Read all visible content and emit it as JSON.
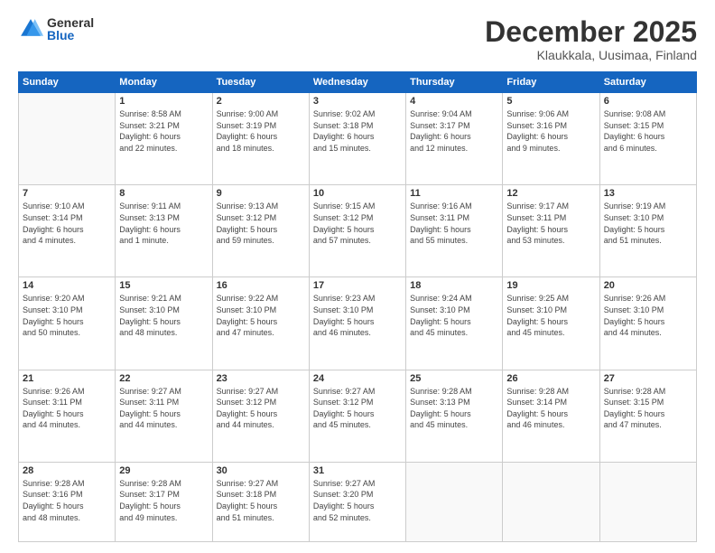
{
  "logo": {
    "general": "General",
    "blue": "Blue"
  },
  "title": "December 2025",
  "subtitle": "Klaukkala, Uusimaa, Finland",
  "days": [
    "Sunday",
    "Monday",
    "Tuesday",
    "Wednesday",
    "Thursday",
    "Friday",
    "Saturday"
  ],
  "weeks": [
    [
      {
        "num": "",
        "text": ""
      },
      {
        "num": "1",
        "text": "Sunrise: 8:58 AM\nSunset: 3:21 PM\nDaylight: 6 hours\nand 22 minutes."
      },
      {
        "num": "2",
        "text": "Sunrise: 9:00 AM\nSunset: 3:19 PM\nDaylight: 6 hours\nand 18 minutes."
      },
      {
        "num": "3",
        "text": "Sunrise: 9:02 AM\nSunset: 3:18 PM\nDaylight: 6 hours\nand 15 minutes."
      },
      {
        "num": "4",
        "text": "Sunrise: 9:04 AM\nSunset: 3:17 PM\nDaylight: 6 hours\nand 12 minutes."
      },
      {
        "num": "5",
        "text": "Sunrise: 9:06 AM\nSunset: 3:16 PM\nDaylight: 6 hours\nand 9 minutes."
      },
      {
        "num": "6",
        "text": "Sunrise: 9:08 AM\nSunset: 3:15 PM\nDaylight: 6 hours\nand 6 minutes."
      }
    ],
    [
      {
        "num": "7",
        "text": "Sunrise: 9:10 AM\nSunset: 3:14 PM\nDaylight: 6 hours\nand 4 minutes."
      },
      {
        "num": "8",
        "text": "Sunrise: 9:11 AM\nSunset: 3:13 PM\nDaylight: 6 hours\nand 1 minute."
      },
      {
        "num": "9",
        "text": "Sunrise: 9:13 AM\nSunset: 3:12 PM\nDaylight: 5 hours\nand 59 minutes."
      },
      {
        "num": "10",
        "text": "Sunrise: 9:15 AM\nSunset: 3:12 PM\nDaylight: 5 hours\nand 57 minutes."
      },
      {
        "num": "11",
        "text": "Sunrise: 9:16 AM\nSunset: 3:11 PM\nDaylight: 5 hours\nand 55 minutes."
      },
      {
        "num": "12",
        "text": "Sunrise: 9:17 AM\nSunset: 3:11 PM\nDaylight: 5 hours\nand 53 minutes."
      },
      {
        "num": "13",
        "text": "Sunrise: 9:19 AM\nSunset: 3:10 PM\nDaylight: 5 hours\nand 51 minutes."
      }
    ],
    [
      {
        "num": "14",
        "text": "Sunrise: 9:20 AM\nSunset: 3:10 PM\nDaylight: 5 hours\nand 50 minutes."
      },
      {
        "num": "15",
        "text": "Sunrise: 9:21 AM\nSunset: 3:10 PM\nDaylight: 5 hours\nand 48 minutes."
      },
      {
        "num": "16",
        "text": "Sunrise: 9:22 AM\nSunset: 3:10 PM\nDaylight: 5 hours\nand 47 minutes."
      },
      {
        "num": "17",
        "text": "Sunrise: 9:23 AM\nSunset: 3:10 PM\nDaylight: 5 hours\nand 46 minutes."
      },
      {
        "num": "18",
        "text": "Sunrise: 9:24 AM\nSunset: 3:10 PM\nDaylight: 5 hours\nand 45 minutes."
      },
      {
        "num": "19",
        "text": "Sunrise: 9:25 AM\nSunset: 3:10 PM\nDaylight: 5 hours\nand 45 minutes."
      },
      {
        "num": "20",
        "text": "Sunrise: 9:26 AM\nSunset: 3:10 PM\nDaylight: 5 hours\nand 44 minutes."
      }
    ],
    [
      {
        "num": "21",
        "text": "Sunrise: 9:26 AM\nSunset: 3:11 PM\nDaylight: 5 hours\nand 44 minutes."
      },
      {
        "num": "22",
        "text": "Sunrise: 9:27 AM\nSunset: 3:11 PM\nDaylight: 5 hours\nand 44 minutes."
      },
      {
        "num": "23",
        "text": "Sunrise: 9:27 AM\nSunset: 3:12 PM\nDaylight: 5 hours\nand 44 minutes."
      },
      {
        "num": "24",
        "text": "Sunrise: 9:27 AM\nSunset: 3:12 PM\nDaylight: 5 hours\nand 45 minutes."
      },
      {
        "num": "25",
        "text": "Sunrise: 9:28 AM\nSunset: 3:13 PM\nDaylight: 5 hours\nand 45 minutes."
      },
      {
        "num": "26",
        "text": "Sunrise: 9:28 AM\nSunset: 3:14 PM\nDaylight: 5 hours\nand 46 minutes."
      },
      {
        "num": "27",
        "text": "Sunrise: 9:28 AM\nSunset: 3:15 PM\nDaylight: 5 hours\nand 47 minutes."
      }
    ],
    [
      {
        "num": "28",
        "text": "Sunrise: 9:28 AM\nSunset: 3:16 PM\nDaylight: 5 hours\nand 48 minutes."
      },
      {
        "num": "29",
        "text": "Sunrise: 9:28 AM\nSunset: 3:17 PM\nDaylight: 5 hours\nand 49 minutes."
      },
      {
        "num": "30",
        "text": "Sunrise: 9:27 AM\nSunset: 3:18 PM\nDaylight: 5 hours\nand 51 minutes."
      },
      {
        "num": "31",
        "text": "Sunrise: 9:27 AM\nSunset: 3:20 PM\nDaylight: 5 hours\nand 52 minutes."
      },
      {
        "num": "",
        "text": ""
      },
      {
        "num": "",
        "text": ""
      },
      {
        "num": "",
        "text": ""
      }
    ]
  ]
}
